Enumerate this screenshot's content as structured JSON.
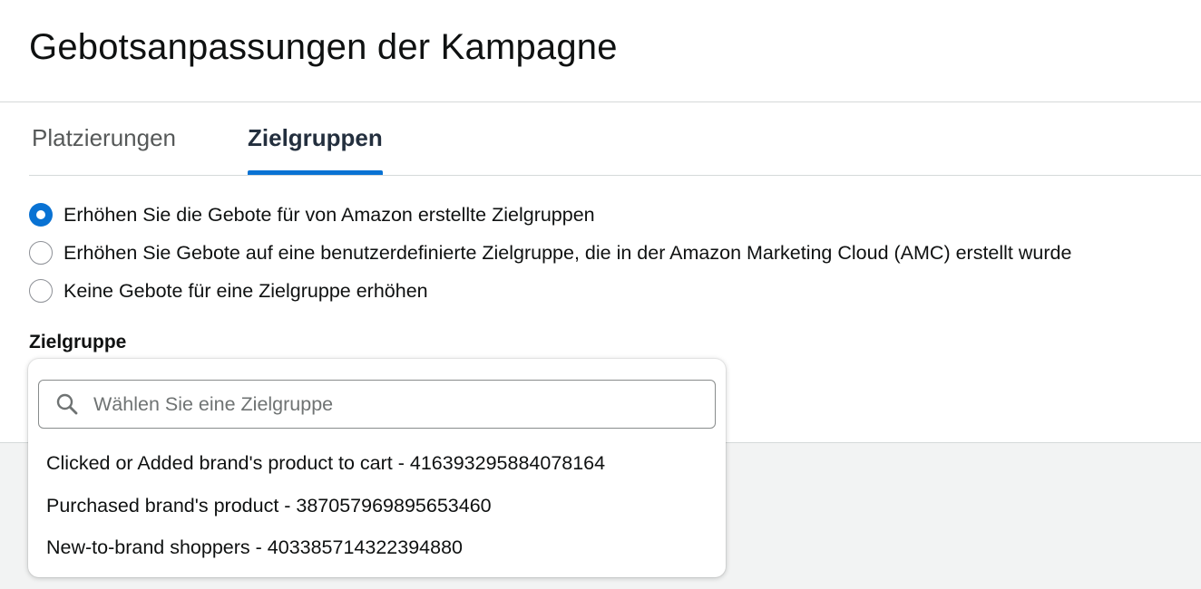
{
  "page": {
    "title": "Gebotsanpassungen der Kampagne"
  },
  "tabs": [
    {
      "label": "Platzierungen",
      "active": false
    },
    {
      "label": "Zielgruppen",
      "active": true
    }
  ],
  "radio_options": [
    {
      "label": "Erhöhen Sie die Gebote für von Amazon erstellte Zielgruppen",
      "checked": true
    },
    {
      "label": "Erhöhen Sie Gebote auf eine benutzerdefinierte Zielgruppe, die in der Amazon Marketing Cloud (AMC) erstellt wurde",
      "checked": false
    },
    {
      "label": "Keine Gebote für eine Zielgruppe erhöhen",
      "checked": false
    }
  ],
  "audience_field": {
    "label": "Zielgruppe",
    "search_placeholder": "Wählen Sie eine Zielgruppe",
    "search_value": "",
    "search_icon": "search-icon",
    "options": [
      "Clicked or Added brand's product to cart - 416393295884078164",
      "Purchased brand's product - 387057969895653460",
      "New-to-brand shoppers - 403385714322394880"
    ]
  },
  "colors": {
    "accent": "#0972d3",
    "text": "#0f1111",
    "tab_inactive": "#565959",
    "divider": "#d5d9d9",
    "panel_bg": "#f2f3f3"
  }
}
